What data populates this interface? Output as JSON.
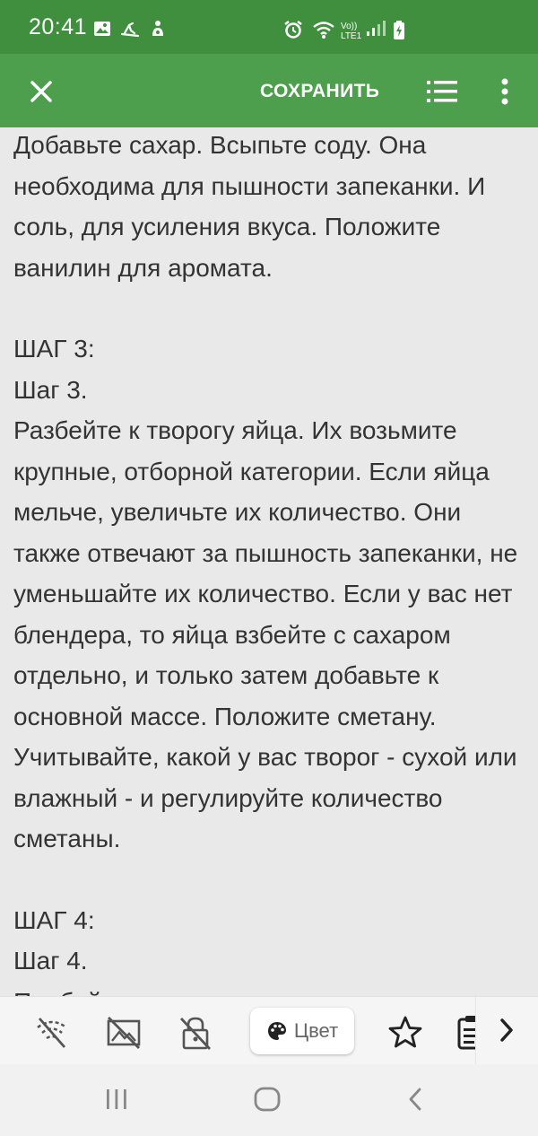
{
  "status_bar": {
    "time": "20:41",
    "network": "Vo)) LTE1"
  },
  "app_bar": {
    "save_label": "СОХРАНИТЬ"
  },
  "content": {
    "paragraphs": [
      "Добавьте сахар. Всыпьте соду. Она необходима для пышности запеканки. И соль, для усиления вкуса. Положите ванилин для аромата.",
      "",
      "ШАГ 3:",
      "Шаг 3.",
      "Разбейте к творогу яйца. Их возьмите крупные, отборной категории. Если яйца мельче, увеличьте их количество. Они также отвечают за пышность запеканки, не уменьшайте их количество. Если у вас нет блендера, то яйца взбейте с сахаром отдельно, и только затем добавьте к основной массе. Положите сметану. Учитывайте, какой у вас творог - сухой или влажный - и регулируйте количество сметаны.",
      "",
      "ШАГ 4:",
      "Шаг 4.",
      "Пробейте все ингредиенты погружным"
    ]
  },
  "toolbar": {
    "items": [
      "wifi-off-icon",
      "image-off-icon",
      "lock-off-icon",
      "palette-icon",
      "star-icon",
      "clipboard-icon",
      "chevron-right-icon"
    ],
    "color_label": "Цвет"
  },
  "colors": {
    "status_bar": "#3f8f3f",
    "app_bar": "#4d9e4d",
    "background": "#e9e9e9",
    "text": "#333333"
  }
}
